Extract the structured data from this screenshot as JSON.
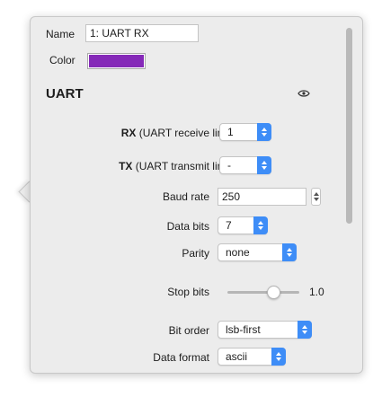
{
  "header": {
    "name_label": "Name",
    "name_value": "1: UART RX",
    "color_label": "Color",
    "color_value": "#8529b8"
  },
  "section": {
    "title": "UART",
    "visibility_icon": "eye-icon"
  },
  "fields": {
    "rx": {
      "label_bold": "RX",
      "label_rest": " (UART receive line)",
      "value": "1"
    },
    "tx": {
      "label_bold": "TX",
      "label_rest": " (UART transmit line)",
      "value": "-"
    },
    "baud_rate": {
      "label": "Baud rate",
      "value": "250"
    },
    "data_bits": {
      "label": "Data bits",
      "value": "7"
    },
    "parity": {
      "label": "Parity",
      "value": "none"
    },
    "stop_bits": {
      "label": "Stop bits",
      "value_text": "1.0",
      "slider_fraction": 0.5
    },
    "bit_order": {
      "label": "Bit order",
      "value": "lsb-first"
    },
    "data_format": {
      "label": "Data format",
      "value": "ascii"
    }
  },
  "colors": {
    "accent": "#3e8df7",
    "panel_bg": "#ececec"
  }
}
